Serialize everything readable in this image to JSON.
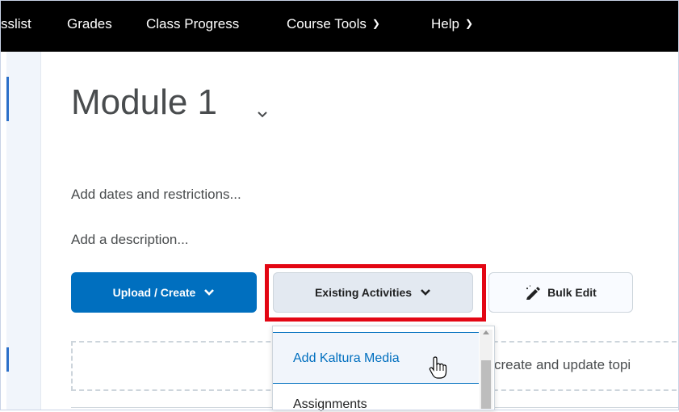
{
  "nav": {
    "items": [
      {
        "label": "sslist"
      },
      {
        "label": "Grades"
      },
      {
        "label": "Class Progress"
      },
      {
        "label": "Course Tools"
      },
      {
        "label": "Help"
      }
    ]
  },
  "module": {
    "title": "Module 1",
    "add_dates_link": "Add dates and restrictions...",
    "add_description_link": "Add a description..."
  },
  "toolbar": {
    "upload_label": "Upload / Create",
    "existing_label": "Existing Activities",
    "bulk_edit_label": "Bulk Edit"
  },
  "dropzone": {
    "text": "create and update topi"
  },
  "dropdown": {
    "items": [
      {
        "label": "Add Kaltura Media"
      },
      {
        "label": "Assignments"
      }
    ]
  },
  "colors": {
    "primary": "#006fbf",
    "highlight": "#e30613",
    "nav_background": "#000000"
  }
}
